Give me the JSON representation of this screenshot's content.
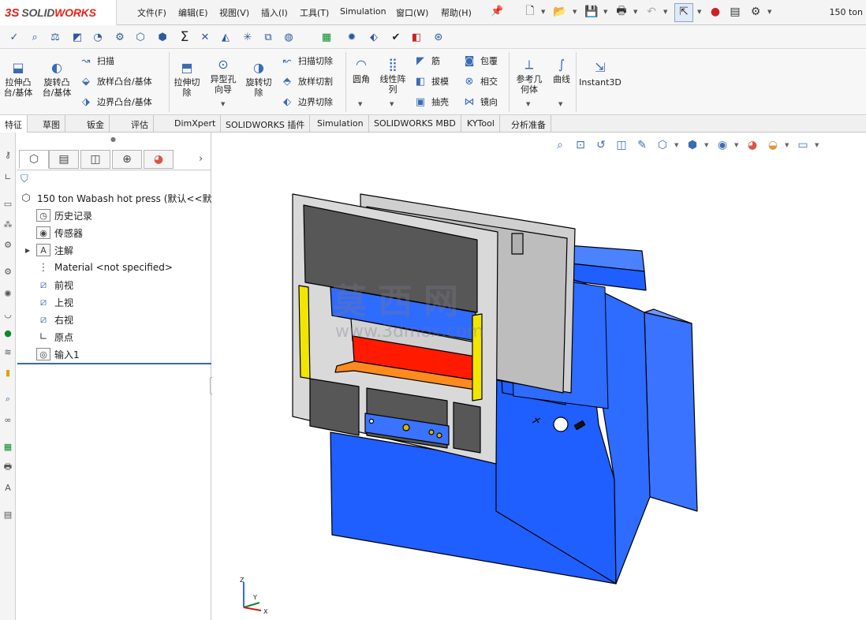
{
  "app": {
    "logo_ds": "3S",
    "logo_solid": "SOLID",
    "logo_works": "WORKS",
    "doc_title": "150 ton"
  },
  "menu": {
    "items": [
      "文件(F)",
      "编辑(E)",
      "视图(V)",
      "插入(I)",
      "工具(T)",
      "Simulation",
      "窗口(W)",
      "帮助(H)"
    ]
  },
  "ribbon": {
    "extrude_boss": "拉伸凸\n台/基体",
    "revolve_boss": "旋转凸\n台/基体",
    "sweep": "扫描",
    "loft": "放样凸台/基体",
    "boundary": "边界凸台/基体",
    "extrude_cut": "拉伸切\n除",
    "hole_wizard": "异型孔\n向导",
    "revolve_cut": "旋转切\n除",
    "swept_cut": "扫描切除",
    "lofted_cut": "放样切割",
    "boundary_cut": "边界切除",
    "fillet": "圆角",
    "linear_pattern": "线性阵\n列",
    "rib": "筋",
    "draft": "拔模",
    "shell": "抽壳",
    "wrap": "包覆",
    "intersect": "相交",
    "mirror": "镜向",
    "ref_geometry": "参考几\n何体",
    "curves": "曲线",
    "instant3d": "Instant3D"
  },
  "tabs": [
    "特征",
    "草图",
    "钣金",
    "评估",
    "DimXpert",
    "SOLIDWORKS 插件",
    "Simulation",
    "SOLIDWORKS MBD",
    "KYTool",
    "分析准备"
  ],
  "tree": {
    "root": "150 ton Wabash hot press  (默认<<默",
    "items": [
      {
        "label": "历史记录",
        "icon": "history-icon"
      },
      {
        "label": "传感器",
        "icon": "sensor-icon"
      },
      {
        "label": "注解",
        "icon": "annotation-icon"
      },
      {
        "label": "Material <not specified>",
        "icon": "material-icon"
      },
      {
        "label": "前视",
        "icon": "plane-icon"
      },
      {
        "label": "上视",
        "icon": "plane-icon"
      },
      {
        "label": "右视",
        "icon": "plane-icon"
      },
      {
        "label": "原点",
        "icon": "origin-icon"
      },
      {
        "label": "输入1",
        "icon": "imported-body-icon"
      }
    ]
  },
  "watermark": {
    "main": "莫西网",
    "url": "www.3dmox.com"
  },
  "triad": {
    "z": "Z",
    "y": "Y",
    "x": "X"
  },
  "colors": {
    "machine_blue": "#1f5fff",
    "frame_grey": "#d9d9d9",
    "platen_red": "#ff1a00",
    "accent_yellow": "#f2e600",
    "brand_red": "#e2231a"
  }
}
